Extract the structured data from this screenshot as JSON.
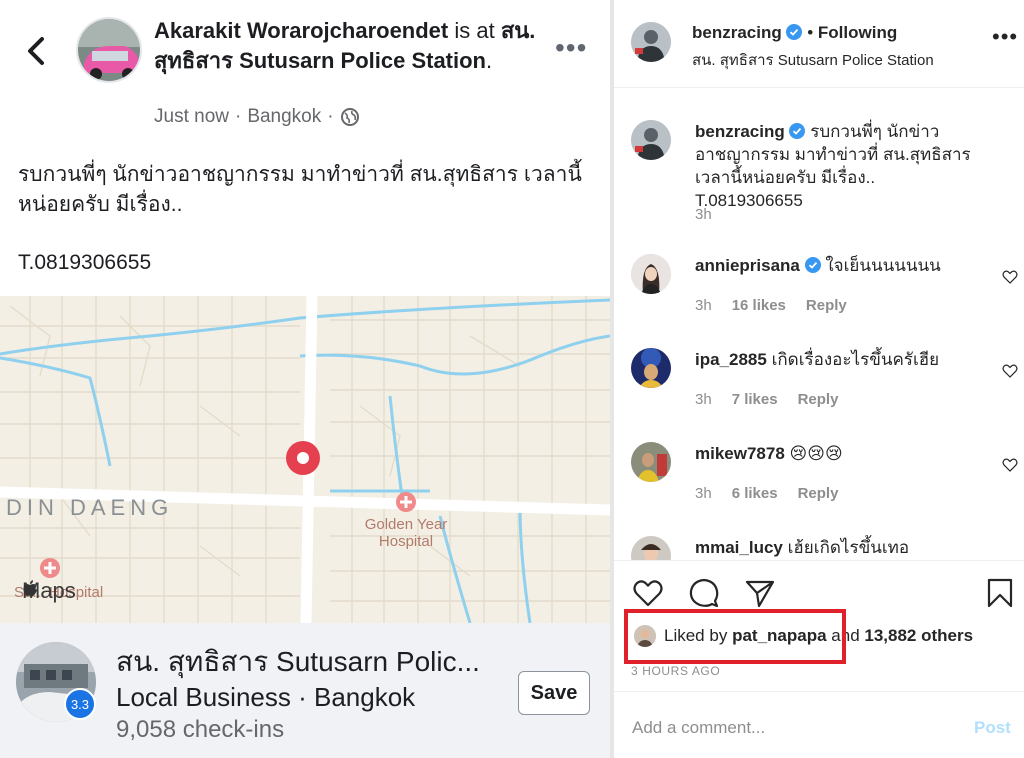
{
  "facebook": {
    "author": "Akarakit Worarojcharoendet",
    "is_at_text": " is at",
    "place_inline": "สน. สุทธิสาร Sutusarn Police Station",
    "place_suffix": ".",
    "time": "Just now",
    "location": "Bangkok",
    "separator": "·",
    "body_line1": "รบกวนพี่ๆ นักข่าวอาชญากรรม มาทำข่าวที่ สน.สุทธิสาร เวลานี้หน่อยครับ มีเรื่อง..",
    "body_phone": "T.0819306655",
    "map": {
      "district_label": "DIN DAENG",
      "hospital_label": "Golden Year Hospital",
      "hospital2_label": "Su... Hospital",
      "brand": "Maps"
    },
    "place_card": {
      "name": "สน. สุทธิสาร Sutusarn Polic...",
      "category": "Local Business · Bangkok",
      "checkins": "9,058 check-ins",
      "rating": "3.3",
      "save_label": "Save"
    }
  },
  "instagram": {
    "header": {
      "username": "benzracing",
      "dot": "•",
      "follow_state": "Following",
      "location": "สน. สุทธิสาร Sutusarn Police Station"
    },
    "caption": {
      "username": "benzracing",
      "text": "รบกวนพี่ๆ นักข่าวอาชญากรรม มาทำข่าวที่ สน.สุทธิสาร เวลานี้หน่อยครับ มีเรื่อง.. T.0819306655",
      "time": "3h"
    },
    "comments": [
      {
        "username": "annieprisana",
        "text": "ใจเย็นนนนนนน",
        "time": "3h",
        "likes": "16 likes",
        "reply": "Reply",
        "verified": true
      },
      {
        "username": "ipa_2885",
        "text": "เกิดเรื่องอะไรขึ้นครัเฮีย",
        "time": "3h",
        "likes": "7 likes",
        "reply": "Reply",
        "verified": false
      },
      {
        "username": "mikew7878",
        "text": "😢😢😢",
        "time": "3h",
        "likes": "6 likes",
        "reply": "Reply",
        "verified": false
      },
      {
        "username": "mmai_lucy",
        "text": "เฮ้ยเกิดไรขึ้นเทอ",
        "time": "",
        "likes": "",
        "reply": "",
        "verified": false
      }
    ],
    "likes": {
      "prefix": "Liked by",
      "user": "pat_napapa",
      "middle": "and",
      "others": "13,882 others"
    },
    "time_ago": "3 HOURS AGO",
    "comment_input_placeholder": "Add a comment...",
    "post_label": "Post",
    "colors": {
      "verified": "#3897f0",
      "highlight": "#e0202a",
      "post_disabled": "#b2dffc"
    }
  }
}
